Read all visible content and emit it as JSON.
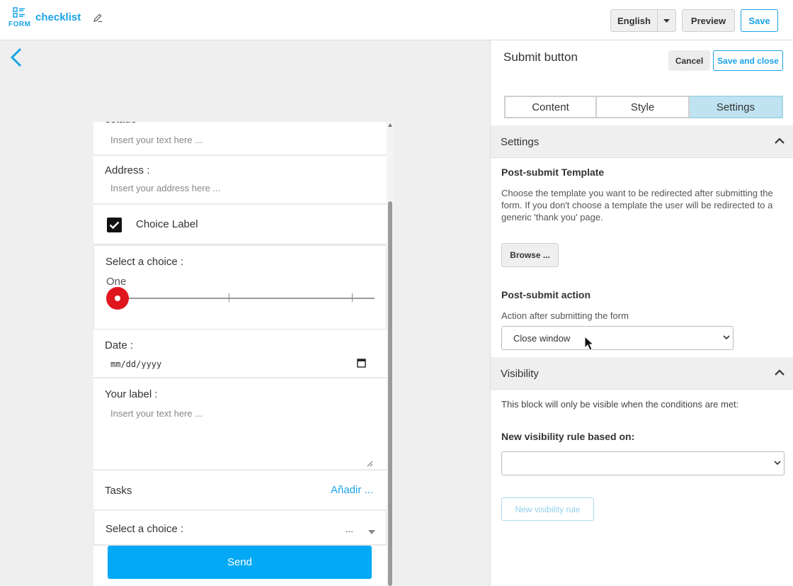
{
  "header": {
    "logo_label": "FORM",
    "title": "checklist",
    "language": "English",
    "preview_label": "Preview",
    "save_label": "Save"
  },
  "form": {
    "field1_label": "estado",
    "field1_placeholder": "Insert your text here ...",
    "address_label": "Address :",
    "address_placeholder": "Insert your address here ...",
    "choice_label": "Choice Label",
    "slider_label": "Select a choice :",
    "slider_value": "One",
    "slider_position": 0,
    "date_label": "Date :",
    "date_placeholder": "mm/dd/yyyy",
    "textarea_label": "Your label :",
    "textarea_placeholder": "Insert your text here ...",
    "tasks_label": "Tasks",
    "tasks_add": "Añadir ...",
    "select_label": "Select a choice :",
    "select_value": "...",
    "send_label": "Send"
  },
  "panel": {
    "title": "Submit button",
    "cancel_label": "Cancel",
    "save_close_label": "Save and close",
    "tabs": [
      "Content",
      "Style",
      "Settings"
    ],
    "active_tab": "Settings",
    "settings_section": "Settings",
    "post_submit_template_heading": "Post-submit Template",
    "post_submit_template_desc": "Choose the template you want to be redirected after submitting the form. If you don't choose a template the user will be redirected to a generic 'thank you' page.",
    "browse_label": "Browse ...",
    "post_submit_action_heading": "Post-submit action",
    "action_caption": "Action after submitting the form",
    "action_value": "Close window",
    "visibility_section": "Visibility",
    "visibility_desc": "This block will only be visible when the conditions are met:",
    "new_rule_heading": "New visibility rule based on:",
    "new_rule_value": "",
    "new_rule_button": "New visibility rule"
  },
  "colors": {
    "accent": "#1aa3e8",
    "slider_handle": "#e0161e",
    "send_button": "#03a9f4",
    "active_tab": "#bfe3f1"
  }
}
